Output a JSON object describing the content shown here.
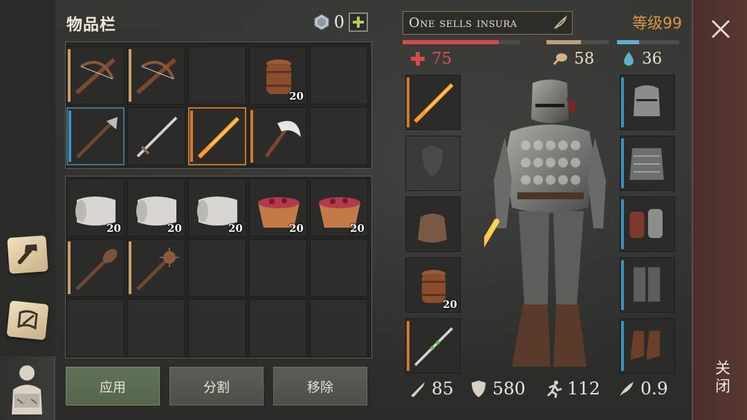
{
  "inventory": {
    "title": "物品栏",
    "currency_value": "0",
    "currency_icon": "gem-icon",
    "add_icon": "plus-icon",
    "slots_top": [
      {
        "item": "crossbow",
        "rarity": "#c7a06a",
        "qty": ""
      },
      {
        "item": "crossbow",
        "rarity": "#c7a06a",
        "qty": ""
      },
      {
        "item": "",
        "rarity": "",
        "qty": ""
      },
      {
        "item": "barrel",
        "rarity": "",
        "qty": "20"
      },
      {
        "item": "",
        "rarity": "",
        "qty": ""
      },
      {
        "item": "halberd",
        "rarity": "#3a94c4",
        "qty": ""
      },
      {
        "item": "sword",
        "rarity": "",
        "qty": ""
      },
      {
        "item": "flaming-sword",
        "rarity": "#d27a2a",
        "qty": ""
      },
      {
        "item": "scythe-axe",
        "rarity": "#d27a2a",
        "qty": ""
      },
      {
        "item": "",
        "rarity": "",
        "qty": ""
      }
    ],
    "slots_bottom": [
      {
        "item": "cloth-roll",
        "rarity": "",
        "qty": "20"
      },
      {
        "item": "cloth-roll",
        "rarity": "",
        "qty": "20"
      },
      {
        "item": "cloth-roll",
        "rarity": "",
        "qty": "20"
      },
      {
        "item": "berry-bowl",
        "rarity": "",
        "qty": "20"
      },
      {
        "item": "berry-bowl",
        "rarity": "",
        "qty": "20"
      },
      {
        "item": "mace",
        "rarity": "#c7a06a",
        "qty": ""
      },
      {
        "item": "morningstar",
        "rarity": "#c7a06a",
        "qty": ""
      },
      {
        "item": "",
        "rarity": "",
        "qty": ""
      },
      {
        "item": "",
        "rarity": "",
        "qty": ""
      },
      {
        "item": "",
        "rarity": "",
        "qty": ""
      },
      {
        "item": "",
        "rarity": "",
        "qty": ""
      },
      {
        "item": "",
        "rarity": "",
        "qty": ""
      },
      {
        "item": "",
        "rarity": "",
        "qty": ""
      },
      {
        "item": "",
        "rarity": "",
        "qty": ""
      },
      {
        "item": "",
        "rarity": "",
        "qty": ""
      }
    ],
    "buttons": {
      "apply": "应用",
      "split": "分割",
      "remove": "移除"
    }
  },
  "character": {
    "name": "One sells insura",
    "level": "等级99",
    "health": "75",
    "food": "58",
    "water": "36",
    "health_fraction": 0.82,
    "food_fraction": 0.55,
    "water_fraction": 0.35,
    "colors": {
      "health": "#d74b47",
      "food": "#b8a078",
      "water": "#5bb3c9",
      "level": "#d99a3c"
    },
    "left_equip": [
      {
        "item": "flaming-sword",
        "rarity": "#d27a2a",
        "qty": ""
      },
      {
        "item": "shield-placeholder",
        "rarity": "",
        "qty": ""
      },
      {
        "item": "pouch",
        "rarity": "",
        "qty": ""
      },
      {
        "item": "barrel",
        "rarity": "",
        "qty": "20"
      },
      {
        "item": "poison-dagger",
        "rarity": "#d27a2a",
        "qty": ""
      }
    ],
    "right_equip": [
      {
        "item": "great-helm",
        "rarity": "#3a94c4"
      },
      {
        "item": "scale-armor",
        "rarity": "#3a94c4"
      },
      {
        "item": "gauntlets",
        "rarity": "#3a94c4"
      },
      {
        "item": "leg-armor",
        "rarity": "#3a94c4"
      },
      {
        "item": "boots",
        "rarity": "#3a94c4"
      }
    ],
    "stats": {
      "attack": "85",
      "armor": "580",
      "speed": "112",
      "weight": "0.9"
    }
  },
  "close": {
    "label": "关闭",
    "icon": "close-icon"
  },
  "sidebar": [
    {
      "icon": "craft-hammer-icon",
      "active": false
    },
    {
      "icon": "quest-scroll-icon",
      "active": false
    },
    {
      "icon": "character-inventory-icon",
      "active": true
    }
  ]
}
